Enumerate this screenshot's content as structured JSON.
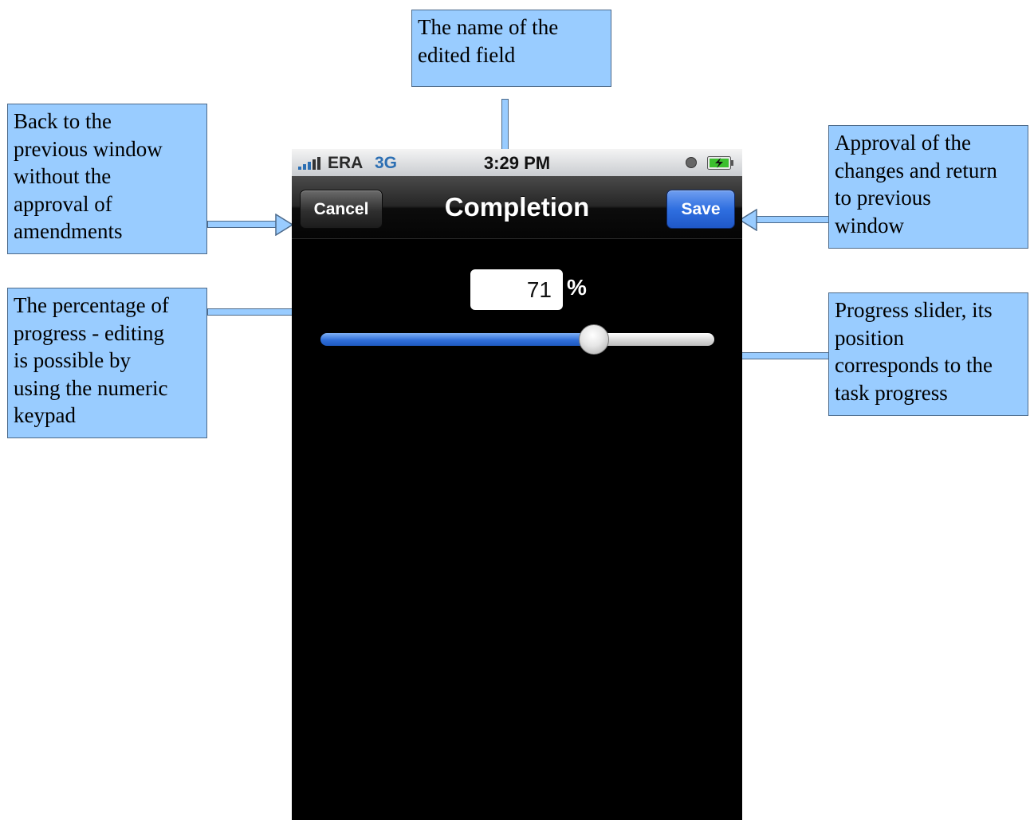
{
  "annotations": {
    "field_name": "The name of the\nedited field",
    "cancel": "Back to the\nprevious window\nwithout the\napproval of\namendments",
    "save": "Approval of the\nchanges and return\nto previous\nwindow",
    "percentage": "The percentage of\nprogress - editing\nis possible by\nusing the numeric\nkeypad",
    "slider": "Progress slider, its\nposition\ncorresponds to the\ntask progress"
  },
  "status_bar": {
    "carrier": "ERA",
    "network": "3G",
    "time": "3:29 PM",
    "icons": [
      "signal-bars-icon",
      "alarm-icon",
      "battery-charging-icon"
    ]
  },
  "nav": {
    "title": "Completion",
    "cancel_label": "Cancel",
    "save_label": "Save"
  },
  "editor": {
    "percent_value": "71",
    "percent_unit": "%",
    "slider_fraction": 0.71
  },
  "colors": {
    "annotation_fill": "#99ccff",
    "save_button": "#2f6fe0",
    "slider_fill": "#2f6ed8",
    "screen_background": "#000000"
  }
}
